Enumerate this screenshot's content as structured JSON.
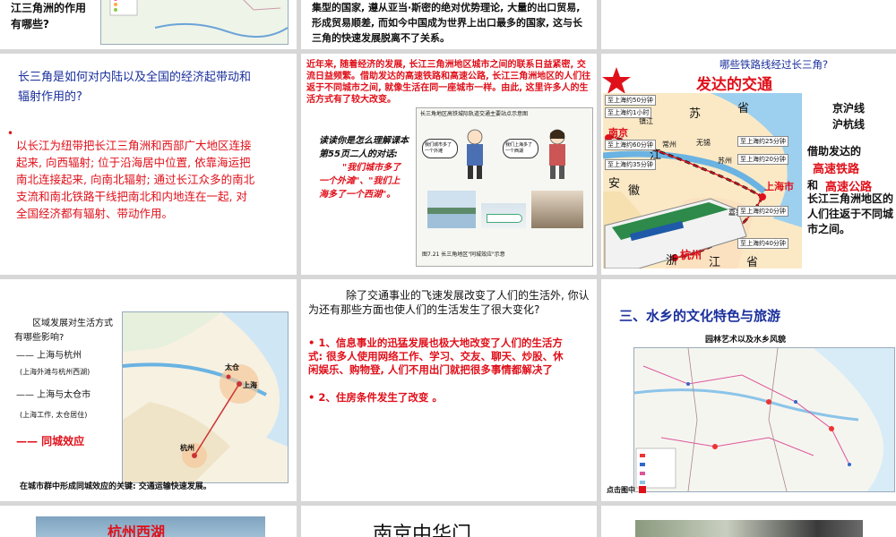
{
  "slides": {
    "s1": {
      "text": "江三角洲的作用\n有哪些?"
    },
    "s2": {
      "text": "集型的国家, 遵从亚当·斯密的绝对优势理论, 大量的出口贸易, 形成贸易顺差, 而如今中国成为世界上出口最多的国家, 这与长三角的快速发展脱离不了关系。"
    },
    "s4": {
      "question": "长三角是如何对内陆以及全国的经济起带动和辐射作用的?",
      "bullet": "•",
      "answer": "以长江为纽带把长江三角洲和西部广大地区连接起来, 向西辐射; 位于沿海居中位置, 依靠海运把南北连接起来, 向南北辐射; 通过长江众多的南北支流和南北铁路干线把南北和内地连在一起, 对全国经济都有辐射、带动作用。"
    },
    "s5": {
      "intro": "近年来, 随着经济的发展, 长江三角洲地区城市之间的联系日益紧密, 交流日益频繁。借助发达的高速铁路和高速公路, 长江三角洲地区的人们往返于不同城市之间, 就像生活在同一座城市一样。由此, 这里许多人的生活方式有了较大改变。",
      "read_prompt": "读读你是怎么理解课本第55页二人的对话:",
      "quote": "\"我们城市多了一个外滩\"、\"我们上海多了一个西湖\"。",
      "panel_title": "长三角地区高铁城际轨道交通主要站点示意图",
      "bubble1": "我们城市多了一个外滩",
      "bubble2": "我们上海多了一个西湖",
      "caption": "图7.21 长三角地区\"同城效应\"示意"
    },
    "s6": {
      "question": "哪些铁路线经过长三角?",
      "title": "发达的交通",
      "lines": "京沪线\n沪杭线",
      "desc1": "借助发达的",
      "hsr": "高速铁路",
      "and": "和",
      "highway": "高速公路",
      "desc2": "长江三角洲地区的人们往返于不同城市之间。",
      "map_labels": {
        "nanjing": "南京",
        "zhenjiang": "镇江",
        "changzhou": "常州",
        "wuxi": "无锡",
        "suzhou": "苏州",
        "shanghai": "上海市",
        "jiaxing": "嘉兴",
        "hangzhou": "杭州",
        "su": "苏",
        "sheng": "省",
        "jiang": "江",
        "an": "安",
        "hui": "徽",
        "zhe": "浙",
        "jiang2": "江",
        "sheng2": "省"
      },
      "times": {
        "t50": "至上海约50分钟",
        "t1h": "至上海约1小时",
        "t60": "至上海约60分钟",
        "t35": "至上海约35分钟",
        "t25": "至上海约25分钟",
        "t20": "至上海约20分钟",
        "t20b": "至上海约20分钟",
        "t40": "至上海约40分钟"
      }
    },
    "s7": {
      "question": "区域发展对生活方式有哪些影响?",
      "item1": "—— 上海与杭州",
      "item1sub": "(上海外滩与杭州西湖)",
      "item2": "—— 上海与太仓市",
      "item2sub": "(上海工作, 太仓居住)",
      "effect": "—— 同城效应",
      "map_taicang": "太仓",
      "map_shanghai": "上海",
      "map_hangzhou": "杭州",
      "key": "在城市群中形成同城效应的关键: 交通运输快速发展。"
    },
    "s8": {
      "question": "除了交通事业的飞速发展改变了人们的生活外, 你认为还有那些方面也使人们的生活发生了很大变化?",
      "a1": "• 1、信息事业的迅猛发展也极大地改变了人们的生活方式: 很多人使用网络工作、学习、交友、聊天、炒股、休闲娱乐、购物登, 人们不用出门就把很多事情都解决了",
      "a2": "• 2、住房条件发生了改变 。"
    },
    "s9": {
      "heading": "三、水乡的文化特色与旅游",
      "subtitle": "园林艺术以及水乡风貌",
      "link": "点击图中"
    },
    "s10": {
      "title": "杭州西湖"
    },
    "s11": {
      "title": "南京中华门"
    }
  },
  "colors": {
    "blue": "#1a2f9c",
    "red": "#e0101a",
    "bg": "#d7d7d7",
    "star": "#e0101a"
  }
}
